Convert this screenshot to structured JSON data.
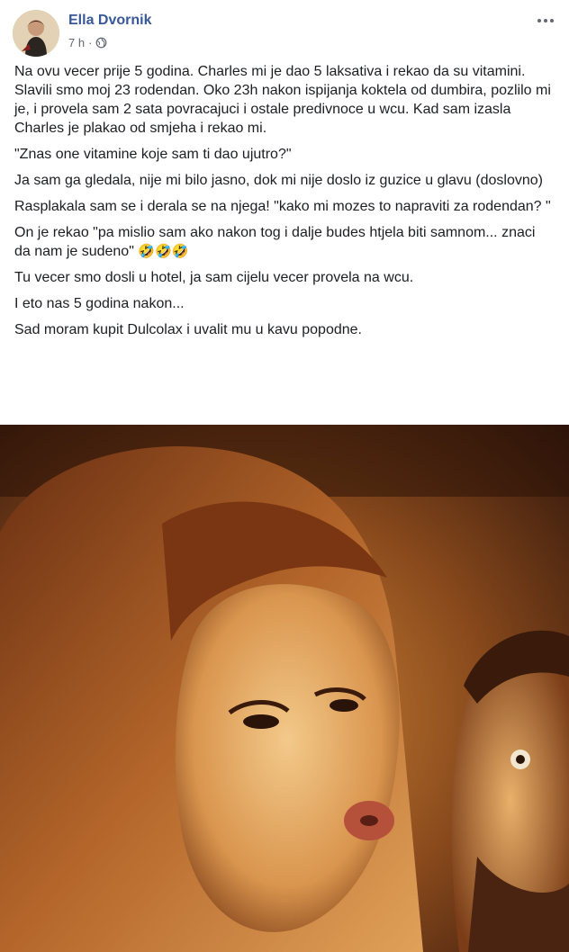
{
  "post": {
    "author": "Ella Dvornik",
    "time": "7 h",
    "dot": "·",
    "paragraphs": [
      "Na ovu vecer prije 5 godina. Charles mi je dao 5 laksativa i rekao da su vitamini. Slavili smo moj 23 rodendan. Oko 23h nakon ispijanja koktela od dumbira, pozlilo mi je, i provela sam 2 sata povracajuci i ostale predivnoce u wcu. Kad sam izasla Charles je plakao od smjeha i rekao mi.",
      "\"Znas one vitamine koje sam ti dao ujutro?\"",
      "Ja sam ga gledala, nije mi bilo jasno, dok mi nije doslo iz guzice u glavu (doslovno)",
      "Rasplakala sam se i derala se na njega! \"kako mi mozes to napraviti za rodendan? \"",
      "On je rekao \"pa mislio sam ako nakon tog i dalje budes htjela biti samnom... znaci da nam je sudeno\"",
      "Tu vecer smo dosli u hotel, ja sam cijelu vecer provela na wcu.",
      "I eto nas 5 godina nakon...",
      "Sad moram kupit Dulcolax i uvalit mu u kavu popodne."
    ],
    "emoji": "🤣🤣🤣"
  },
  "icons": {
    "privacy": "globe-icon",
    "more": "more-options-icon"
  },
  "colors": {
    "author": "#385898",
    "meta": "#606770",
    "text": "#1c1e21"
  }
}
